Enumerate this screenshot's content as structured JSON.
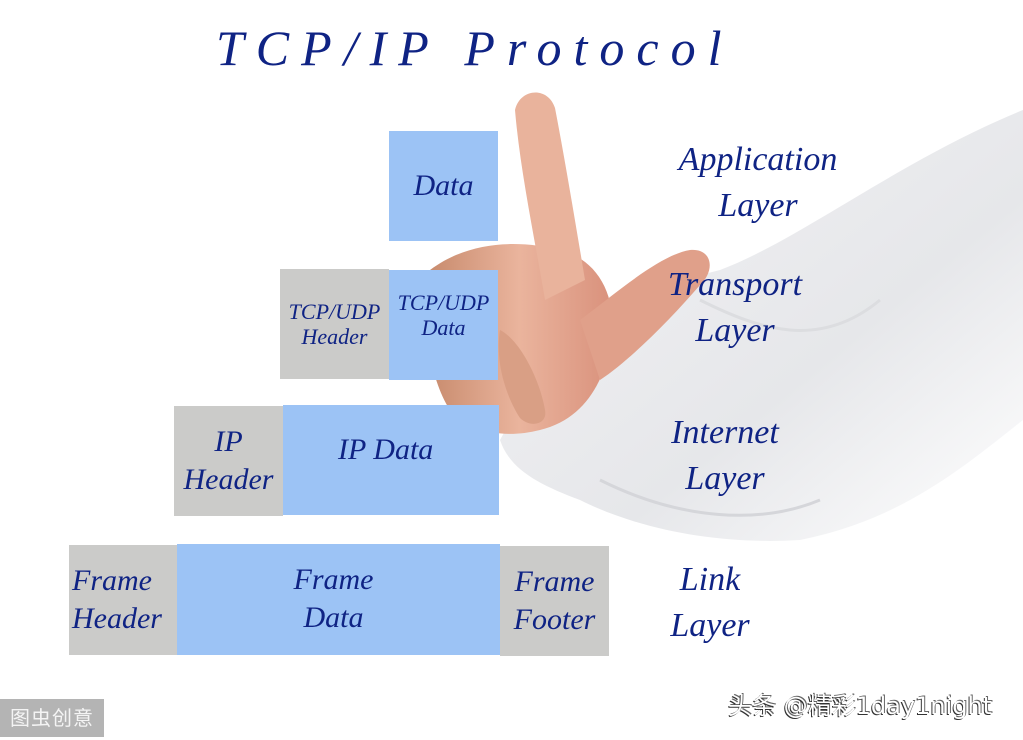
{
  "title": "TCP/IP Protocol",
  "colors": {
    "text": "#0f2384",
    "data_box": "#9cc3f5",
    "header_box": "#cbcbc9"
  },
  "stack": {
    "application": {
      "data": "Data"
    },
    "transport": {
      "header_line1": "TCP/UDP",
      "header_line2": "Header",
      "data_line1": "TCP/UDP",
      "data_line2": "Data"
    },
    "internet": {
      "header_line1": "IP",
      "header_line2": "Header",
      "data": "IP Data"
    },
    "link": {
      "header_line1": "Frame",
      "header_line2": "Header",
      "data_line1": "Frame",
      "data_line2": "Data",
      "footer_line1": "Frame",
      "footer_line2": "Footer"
    }
  },
  "layers": [
    {
      "line1": "Application",
      "line2": "Layer"
    },
    {
      "line1": "Transport",
      "line2": "Layer"
    },
    {
      "line1": "Internet",
      "line2": "Layer"
    },
    {
      "line1": "Link",
      "line2": "Layer"
    }
  ],
  "illustration": "hand-pointing-up-in-white-sleeve",
  "watermarks": {
    "left": "图虫创意",
    "right": "头条 @精彩1day1night"
  }
}
